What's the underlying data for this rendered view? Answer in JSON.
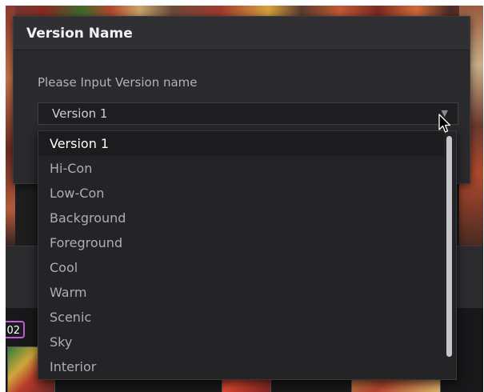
{
  "dialog": {
    "title": "Version Name",
    "prompt": "Please Input Version name",
    "select": {
      "value": "Version 1"
    }
  },
  "dropdown": {
    "selected_index": 0,
    "items": [
      {
        "label": "Version 1"
      },
      {
        "label": "Hi-Con"
      },
      {
        "label": "Low-Con"
      },
      {
        "label": "Background"
      },
      {
        "label": "Foreground"
      },
      {
        "label": "Cool"
      },
      {
        "label": "Warm"
      },
      {
        "label": "Scenic"
      },
      {
        "label": "Sky"
      },
      {
        "label": "Interior"
      }
    ]
  },
  "background": {
    "timecode": "02"
  },
  "icons": {
    "dropdown": "chevron-down-icon",
    "cursor": "mouse-cursor-icon"
  },
  "colors": {
    "dialog_bg": "#2a2a2d",
    "dropdown_bg": "#242427",
    "badge_border": "#c45bd6"
  }
}
